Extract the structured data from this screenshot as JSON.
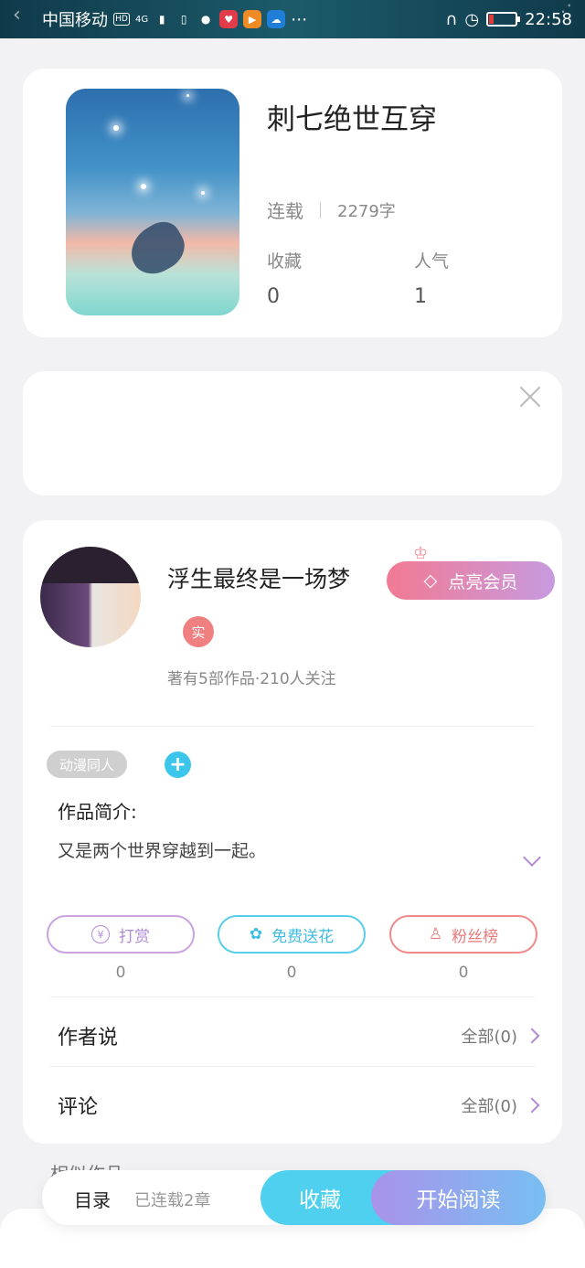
{
  "status_bar": {
    "carrier": "中国移动",
    "hd": "HD",
    "network": "4G",
    "time": "22:58"
  },
  "book": {
    "title": "刺七绝世互穿",
    "status": "连载",
    "word_count": "2279字",
    "favorites_label": "收藏",
    "favorites_value": "0",
    "popularity_label": "人气",
    "popularity_value": "1"
  },
  "author": {
    "name": "浮生最终是一场梦",
    "vip_label": "点亮会员",
    "real_badge": "实",
    "info": "著有5部作品·210人关注"
  },
  "work": {
    "tag": "动漫同人",
    "tag_add": "+",
    "intro_title": "作品简介:",
    "intro_text": "又是两个世界穿越到一起。"
  },
  "actions": {
    "reward_label": "打赏",
    "reward_count": "0",
    "flower_label": "免费送花",
    "flower_count": "0",
    "fans_label": "粉丝榜",
    "fans_count": "0"
  },
  "rows": {
    "author_says_label": "作者说",
    "author_says_more": "全部(0)",
    "comments_label": "评论",
    "comments_more": "全部(0)"
  },
  "peek_text": "相似作品",
  "bottom_bar": {
    "toc_label": "目录",
    "chapters": "已连载2章",
    "favorite_label": "收藏",
    "read_label": "开始阅读"
  },
  "colors": {
    "accent_blue": "#4fd0ef",
    "accent_purple": "#b28ad6",
    "accent_pink": "#f27a92"
  }
}
